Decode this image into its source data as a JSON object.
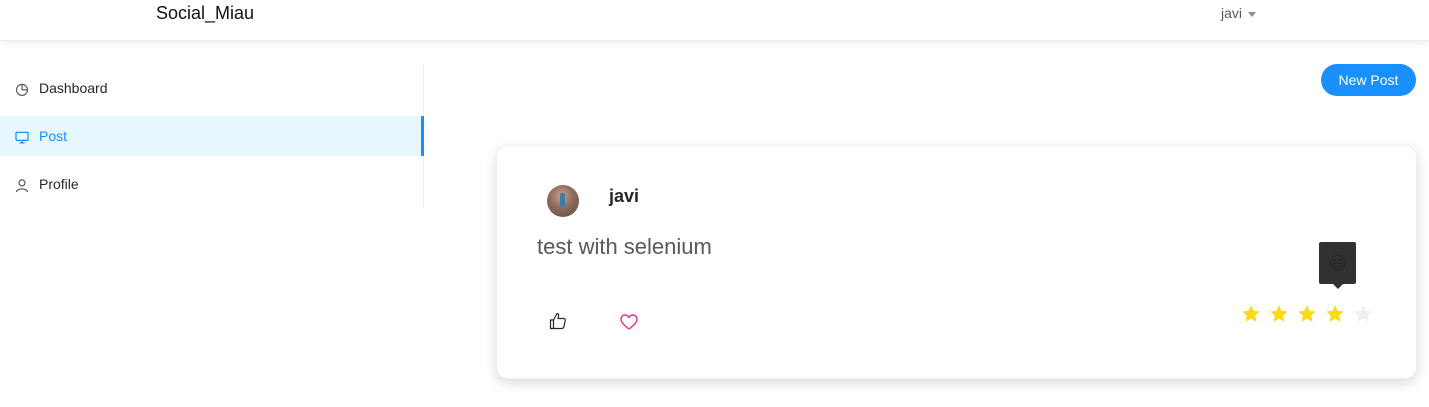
{
  "header": {
    "brand": "Social_Miau",
    "user": "javi"
  },
  "sidebar": {
    "items": [
      {
        "label": "Dashboard",
        "icon": "pie-chart-icon",
        "active": false
      },
      {
        "label": "Post",
        "icon": "desktop-icon",
        "active": true
      },
      {
        "label": "Profile",
        "icon": "user-icon",
        "active": false
      }
    ]
  },
  "toolbar": {
    "new_post_label": "New Post"
  },
  "post": {
    "author": "javi",
    "content": "test with selenium",
    "rating": 4,
    "rating_max": 5,
    "tooltip": "😃"
  },
  "colors": {
    "accent": "#1890ff",
    "star": "#fadb14",
    "heart": "#eb2f96",
    "star_empty": "#f0f0f0"
  }
}
